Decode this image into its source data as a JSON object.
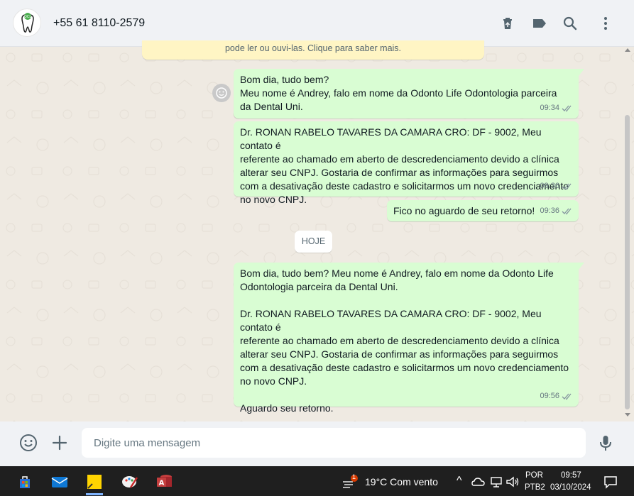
{
  "header": {
    "contact_name": "+55 61 8110-2579",
    "icons": [
      "delete-icon",
      "label-icon",
      "search-icon",
      "menu-icon"
    ]
  },
  "notice": {
    "text": "pode ler ou ouvi-las. Clique para saber mais."
  },
  "messages": [
    {
      "text": "Bom dia, tudo bem?\nMeu nome é Andrey, falo em nome da Odonto Life Odontologia parceira\nda Dental Uni.",
      "time": "09:34"
    },
    {
      "text": "Dr. RONAN RABELO TAVARES DA CAMARA CRO: DF - 9002, Meu contato é\nreferente ao chamado em aberto de descredenciamento devido a clínica\nalterar seu CNPJ. Gostaria de confirmar as informações para seguirmos\ncom a desativação deste cadastro e solicitarmos um novo credenciamento\nno novo CNPJ.",
      "time": "09:36"
    },
    {
      "text": "Fico no aguardo de seu retorno!",
      "time": "09:36"
    },
    {
      "text": "Bom dia, tudo bem? Meu nome é Andrey, falo em nome da Odonto Life\nOdontologia parceira da Dental Uni.\n\nDr. RONAN RABELO TAVARES DA CAMARA CRO: DF - 9002, Meu contato é\nreferente ao chamado em aberto de descredenciamento devido a clínica\nalterar seu CNPJ. Gostaria de confirmar as informações para seguirmos\ncom a desativação deste cadastro e solicitarmos um novo credenciamento\nno novo CNPJ.\n\nAguardo seu retorno.",
      "time": "09:56"
    }
  ],
  "date_divider": "HOJE",
  "composer": {
    "placeholder": "Digite uma mensagem"
  },
  "taskbar": {
    "weather": "19°C  Com vento",
    "weather_badge": "1",
    "lang": "POR",
    "layout": "PTB2",
    "time": "09:57",
    "date": "03/10/2024"
  },
  "colors": {
    "outgoing_bubble": "#d9fdd3",
    "chat_bg": "#efeae2",
    "header_bg": "#f0f2f5",
    "tick": "#8696a0"
  }
}
